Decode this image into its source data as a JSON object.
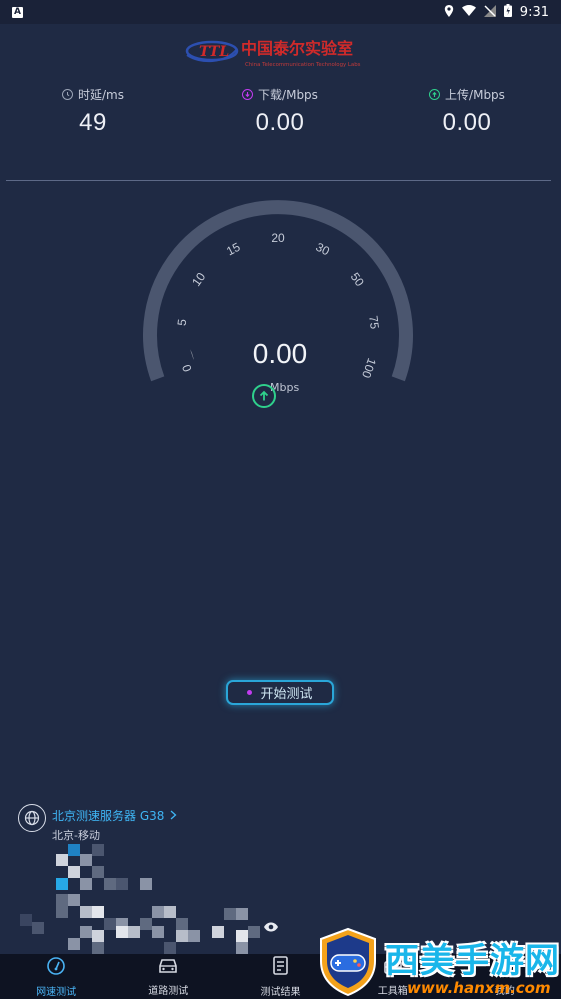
{
  "status_bar": {
    "left_badge": "A",
    "time": "9:31",
    "icons": [
      "location-icon",
      "wifi-icon",
      "no-sim-icon",
      "battery-icon"
    ]
  },
  "logo": {
    "mark": "TTL",
    "title": "中国泰尔实验室",
    "subtitle": "China Telecommunication Technology Labs"
  },
  "metrics": [
    {
      "label": "时延/ms",
      "value": "49",
      "icon": "clock-icon",
      "color": "#9aa3b5"
    },
    {
      "label": "下载/Mbps",
      "value": "0.00",
      "icon": "download-icon",
      "color": "#c23cf0"
    },
    {
      "label": "上传/Mbps",
      "value": "0.00",
      "icon": "upload-icon",
      "color": "#2fd08c"
    }
  ],
  "gauge": {
    "ticks": [
      "0",
      "5",
      "10",
      "15",
      "20",
      "30",
      "50",
      "75",
      "100"
    ],
    "value": "0.00",
    "unit": "Mbps",
    "needle_fraction": 0.08
  },
  "start_button": {
    "label": "开始测试"
  },
  "server": {
    "name": "北京测速服务器 G38",
    "location": "北京-移动"
  },
  "nav": [
    {
      "label": "网速测试",
      "icon": "speed-icon",
      "active": true
    },
    {
      "label": "道路测试",
      "icon": "car-icon",
      "active": false
    },
    {
      "label": "测试结果",
      "icon": "report-icon",
      "active": false
    },
    {
      "label": "工具箱",
      "icon": "toolbox-icon",
      "active": false
    },
    {
      "label": "我的",
      "icon": "profile-icon",
      "active": false
    }
  ],
  "watermark": {
    "text": "西美手游网",
    "url": "www.hanxm.com"
  }
}
